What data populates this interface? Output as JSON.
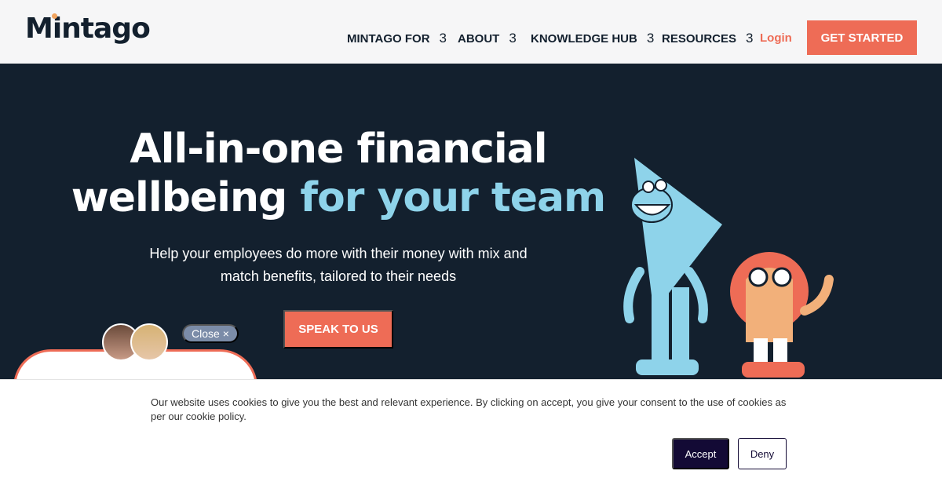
{
  "header": {
    "logo": "Mintago",
    "nav": [
      {
        "label": "MINTAGO FOR",
        "chevron": "3"
      },
      {
        "label": "ABOUT",
        "chevron": "3"
      },
      {
        "label": "KNOWLEDGE HUB",
        "chevron": "3"
      },
      {
        "label": "RESOURCES",
        "chevron": "3"
      }
    ],
    "login": "Login",
    "cta": "GET STARTED"
  },
  "hero": {
    "title_line1": "All-in-one financial",
    "title_line2_plain": "wellbeing ",
    "title_line2_accent": "for your team",
    "subtitle": "Help your employees do more with their money with mix and match benefits, tailored to their needs",
    "cta": "SPEAK TO US",
    "accent_color": "#8ed3ea",
    "brand_color": "#ee6c56"
  },
  "chat": {
    "close_label": "Close",
    "close_icon": "×"
  },
  "cookie": {
    "text": "Our website uses cookies to give you the best and relevant experience. By clicking on accept, you give your consent to the use of cookies as per our cookie policy.",
    "accept": "Accept",
    "deny": "Deny"
  }
}
